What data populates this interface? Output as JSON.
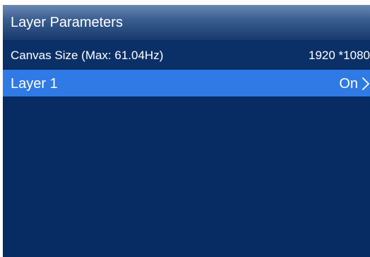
{
  "header": {
    "title": "Layer Parameters"
  },
  "rows": [
    {
      "label": "Canvas Size (Max: 61.04Hz)",
      "value": "1920 *1080"
    },
    {
      "label": "Layer 1",
      "value": "On",
      "selected": true
    }
  ],
  "colors": {
    "background": "#062c63",
    "header_top": "#6b89b4",
    "header_bottom": "#17396c",
    "selection": "#2f7ae5",
    "text": "#ffffff"
  },
  "icons": {
    "layer_chevron": "chevron-right-icon"
  }
}
